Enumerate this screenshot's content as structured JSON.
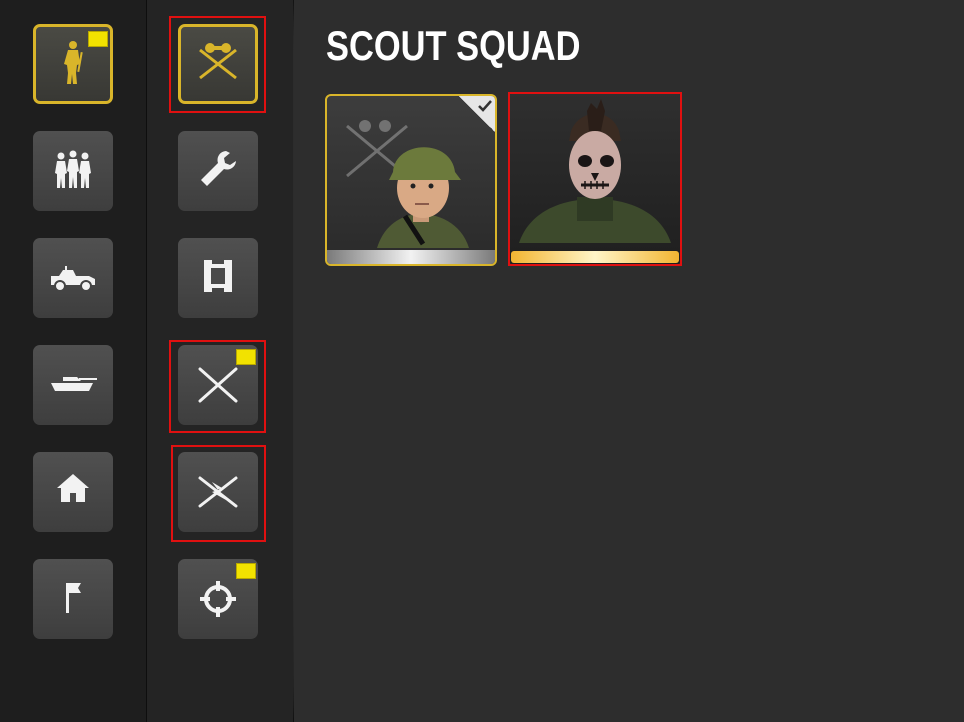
{
  "title": "SCOUT SQUAD",
  "colors": {
    "accent_gold": "#d9b52a",
    "highlight_red": "#e01010",
    "new_flag_yellow": "#f2e200",
    "tile_gray": "#4a4a4a"
  },
  "category_tabs": [
    {
      "icon": "infantry-soldier-icon",
      "selected": true,
      "new": true
    },
    {
      "icon": "squad-group-icon",
      "selected": false,
      "new": false
    },
    {
      "icon": "jeep-icon",
      "selected": false,
      "new": false
    },
    {
      "icon": "tank-icon",
      "selected": false,
      "new": false
    },
    {
      "icon": "house-icon",
      "selected": false,
      "new": false
    },
    {
      "icon": "flag-icon",
      "selected": false,
      "new": false
    }
  ],
  "subcategory_tabs": [
    {
      "icon": "binoculars-crossed-rifles-icon",
      "selected": true,
      "new": false,
      "highlighted": true
    },
    {
      "icon": "wrench-icon",
      "selected": false,
      "new": false,
      "highlighted": false
    },
    {
      "icon": "engineer-castle-icon",
      "selected": false,
      "new": false,
      "highlighted": false
    },
    {
      "icon": "crossed-rifles-icon",
      "selected": false,
      "new": true,
      "highlighted": true
    },
    {
      "icon": "signal-lightning-icon",
      "selected": false,
      "new": false,
      "highlighted": true
    },
    {
      "icon": "crosshair-icon",
      "selected": false,
      "new": true,
      "highlighted": false
    }
  ],
  "units": [
    {
      "portrait": "scout-helmet-soldier",
      "selected": true,
      "checked": true,
      "highlighted": false
    },
    {
      "portrait": "skull-face-mohawk-soldier",
      "selected": false,
      "checked": false,
      "highlighted": true
    }
  ]
}
